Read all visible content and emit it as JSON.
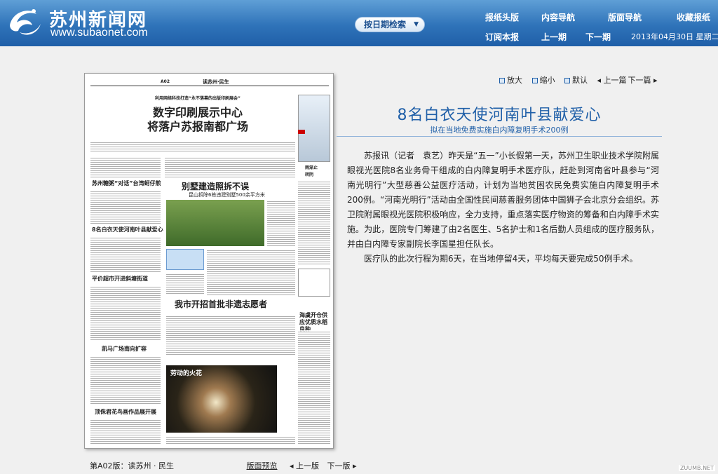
{
  "header": {
    "site_name": "苏州新闻网",
    "site_url": "www.subaonet.com",
    "date_search_label": "按日期检索",
    "nav_row1": [
      "报纸头版",
      "内容导航",
      "版面导航",
      "收藏报纸"
    ],
    "nav_row2": [
      "订阅本报",
      "上一期",
      "下一期"
    ],
    "date_text": "2013年04月30日 星期二",
    "colors": {
      "header_top": "#5f9fd6",
      "header_bottom": "#1f5fa8"
    }
  },
  "controls": {
    "zoom_in": "放大",
    "zoom_out": "缩小",
    "default": "默认",
    "prev_article": "上一篇",
    "next_article": "下一篇"
  },
  "article": {
    "title": "8名白衣天使河南叶县献爱心",
    "subtitle": "拟在当地免费实施白内障复明手术200例",
    "paragraphs": [
      "苏报讯（记者　袁艺）昨天是“五一”小长假第一天，苏州卫生职业技术学院附属眼视光医院8名业务骨干组成的白内障复明手术医疗队，赶赴到河南省叶县参与“河南光明行”大型慈善公益医疗活动，计划为当地贫困农民免费实施白内障复明手术200例。“河南光明行”活动由全国性民间慈善服务团体中国狮子会北京分会组织。苏卫院附属眼视光医院积极响应，全力支持，重点落实医疗物资的筹备和白内障手术实施。为此，医院专门筹建了由2名医生、5名护士和1名后勤人员组成的医疗服务队，并由白内障专家副院长李国星担任队长。",
      "医疗队的此次行程为期6天，在当地停留4天，平均每天要完成50例手术。"
    ]
  },
  "newspaper": {
    "page_label": "A02",
    "section": "读苏州·民生",
    "kicker": "利用网络科技打造“永不落幕的出版印刷展会”",
    "headline": "数字印刷展示中心\n将落户苏报南都广场",
    "stories": [
      "苏州糖粥“对话”台湾蚵仔煎",
      "8名白衣天使河南叶县献爱心",
      "平价超市开进斜塘街道",
      "凯马广场南向扩容",
      "顶侏君花鸟画作品展开展",
      "别墅建造照拆不误",
      "我市开招首批非遗志愿者",
      "劳动的火花",
      "海虞开仓供应优质水稻良种"
    ],
    "photo_caption": "昆山拆除6栋违建别墅500余平方米",
    "weather": [
      "雨渐止",
      "转阴"
    ]
  },
  "footer": {
    "page_name": "第A02版：读苏州 · 民生",
    "preview": "版面预览",
    "prev_page": "上一版",
    "next_page": "下一版"
  },
  "watermark": "ZUUMB.NET"
}
